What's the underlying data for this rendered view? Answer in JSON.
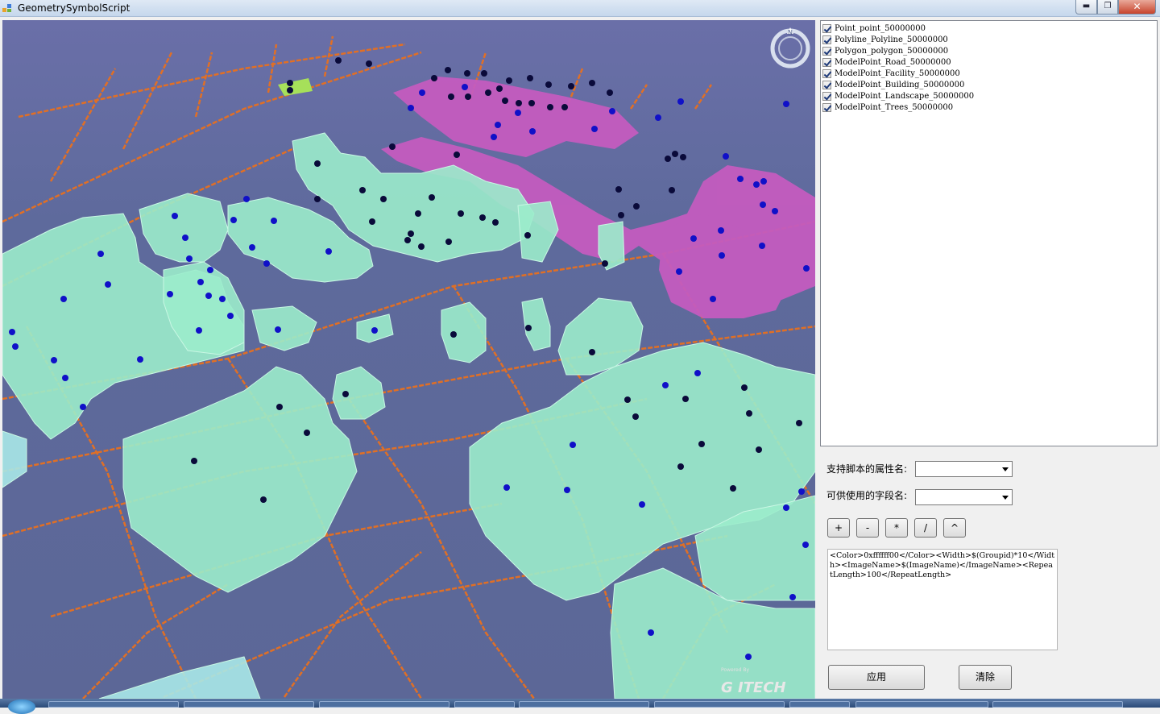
{
  "window": {
    "title": "GeometrySymbolScript",
    "min_glyph": "▬",
    "max_glyph": "❐",
    "close_glyph": "✕"
  },
  "viewport": {
    "compass_label": "N",
    "logo_small": "Powered By",
    "logo_text": "G ITECH"
  },
  "layers": [
    {
      "label": "Point_point_50000000",
      "checked": true
    },
    {
      "label": "Polyline_Polyline_50000000",
      "checked": true
    },
    {
      "label": "Polygon_polygon_50000000",
      "checked": true
    },
    {
      "label": "ModelPoint_Road_50000000",
      "checked": true
    },
    {
      "label": "ModelPoint_Facility_50000000",
      "checked": true
    },
    {
      "label": "ModelPoint_Building_50000000",
      "checked": true
    },
    {
      "label": "ModelPoint_Landscape_50000000",
      "checked": true
    },
    {
      "label": "ModelPoint_Trees_50000000",
      "checked": true
    }
  ],
  "form": {
    "attr_label": "支持脚本的属性名:",
    "attr_value": "",
    "field_label": "可供使用的字段名:",
    "field_value": "",
    "op_plus": "+",
    "op_minus": "-",
    "op_mul": "*",
    "op_div": "/",
    "op_pow": "^",
    "script_text": "<Color>0xffffff00</Color><Width>$(Groupid)*10</Width><ImageName>$(ImageName)</ImageName><RepeatLength>100</RepeatLength>",
    "apply_label": "应用",
    "clear_label": "清除"
  },
  "colors": {
    "ground": "#5f6a9b",
    "building": "#9beccb",
    "district": "#c45cbf",
    "road": "#e8701f",
    "point_dark": "#0a0a3a",
    "point_blue": "#1010c8"
  }
}
